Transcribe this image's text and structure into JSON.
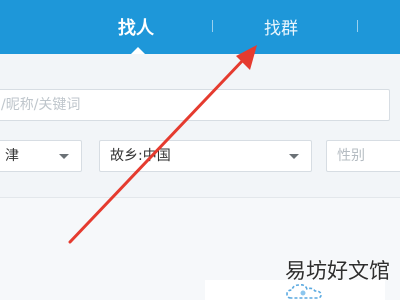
{
  "tabs": {
    "find_people": "找人",
    "find_group": "找群"
  },
  "search": {
    "placeholder": "/昵称/关键词"
  },
  "filters": {
    "location_value": "津",
    "hometown_value": "故乡:中国",
    "gender_placeholder": "性别"
  },
  "watermark": "易坊好文馆",
  "colors": {
    "header_blue": "#1e97d9",
    "arrow_red": "#e53b2f"
  },
  "icons": {
    "arrow": "red-arrow-icon",
    "cloud": "cloud-illustration-icon"
  }
}
